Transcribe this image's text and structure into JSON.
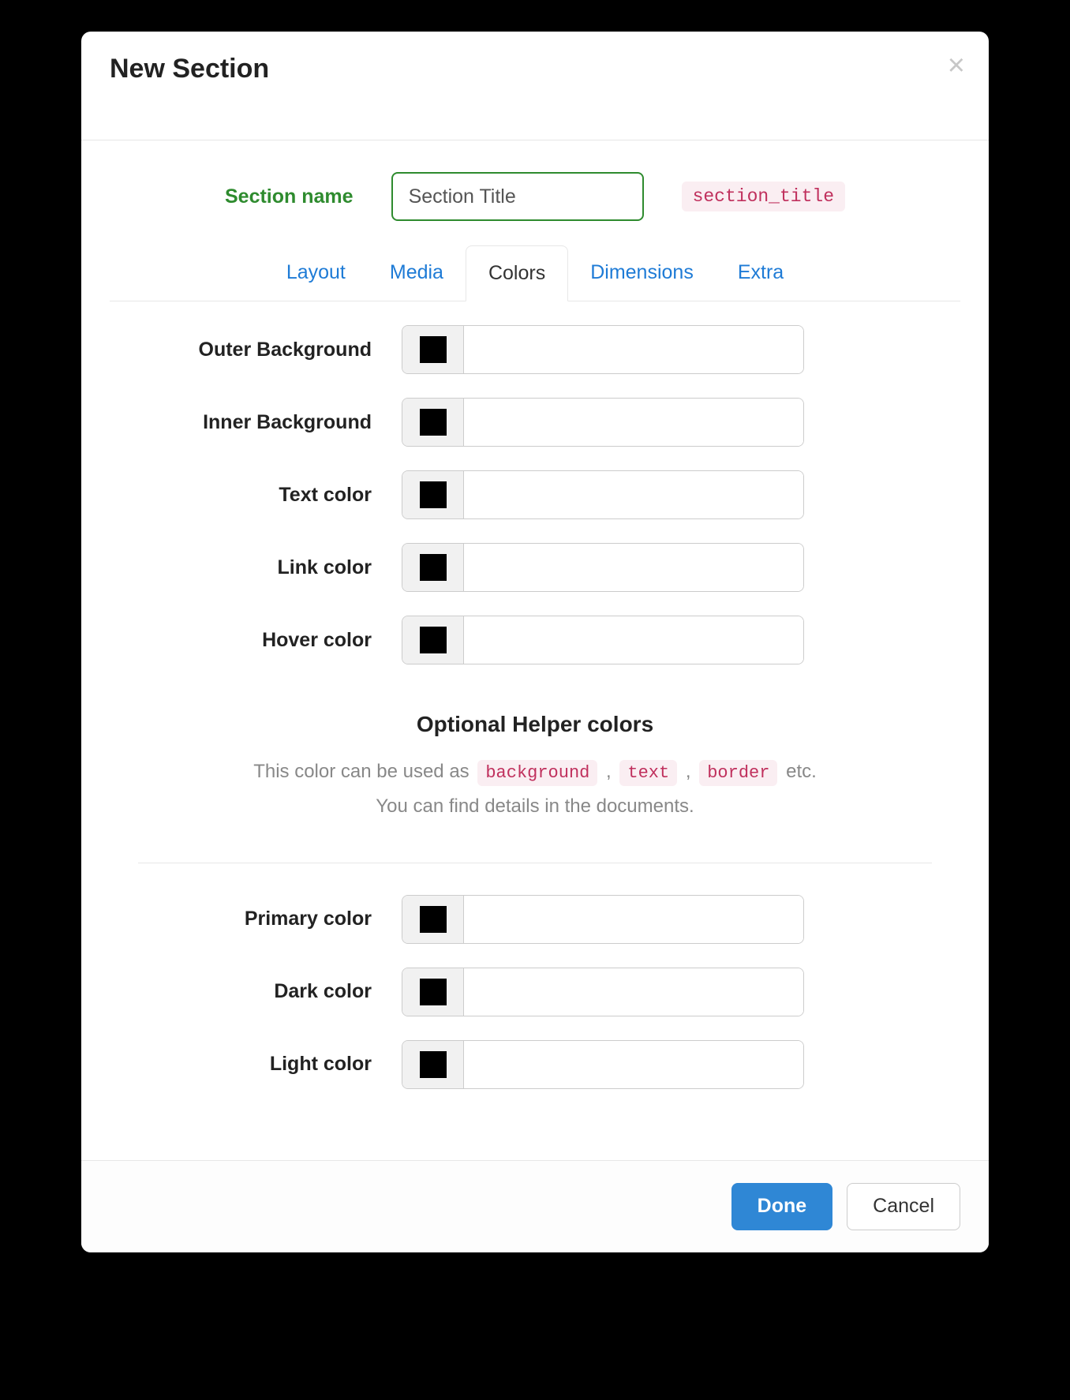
{
  "modal": {
    "title": "New Section",
    "close": "×"
  },
  "section_name": {
    "label": "Section name",
    "value": "Section Title",
    "slug": "section_title"
  },
  "tabs": {
    "layout": "Layout",
    "media": "Media",
    "colors": "Colors",
    "dimensions": "Dimensions",
    "extra": "Extra"
  },
  "fields": {
    "outer_bg": {
      "label": "Outer Background",
      "value": ""
    },
    "inner_bg": {
      "label": "Inner Background",
      "value": ""
    },
    "text_color": {
      "label": "Text color",
      "value": ""
    },
    "link_color": {
      "label": "Link color",
      "value": ""
    },
    "hover_color": {
      "label": "Hover color",
      "value": ""
    },
    "primary_color": {
      "label": "Primary color",
      "value": ""
    },
    "dark_color": {
      "label": "Dark color",
      "value": ""
    },
    "light_color": {
      "label": "Light color",
      "value": ""
    }
  },
  "helper": {
    "title": "Optional Helper colors",
    "desc_prefix": "This color can be used as ",
    "pill_background": "background",
    "sep1": " , ",
    "pill_text": "text",
    "sep2": " , ",
    "pill_border": "border",
    "desc_suffix": " etc.",
    "desc_line2": "You can find details in the documents."
  },
  "footer": {
    "done": "Done",
    "cancel": "Cancel"
  }
}
